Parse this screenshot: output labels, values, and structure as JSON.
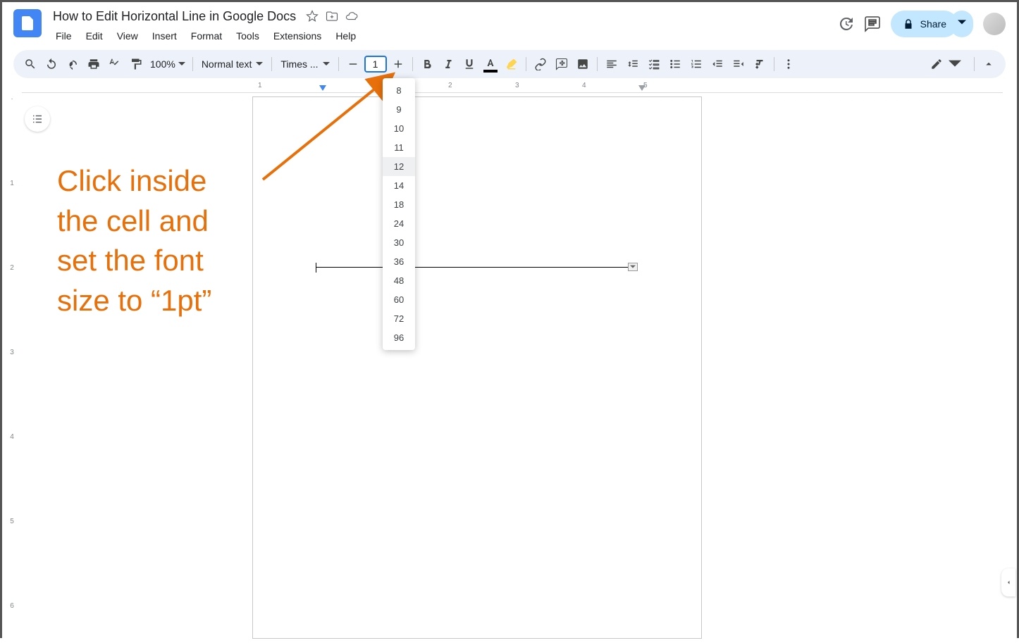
{
  "doc_title": "How to Edit Horizontal Line in Google Docs",
  "menus": [
    "File",
    "Edit",
    "View",
    "Insert",
    "Format",
    "Tools",
    "Extensions",
    "Help"
  ],
  "toolbar": {
    "zoom": "100%",
    "style": "Normal text",
    "font": "Times ...",
    "font_size": "1"
  },
  "share_label": "Share",
  "font_sizes": [
    "8",
    "9",
    "10",
    "11",
    "12",
    "14",
    "18",
    "24",
    "30",
    "36",
    "48",
    "60",
    "72",
    "96"
  ],
  "highlighted_size": "12",
  "hruler_ticks": [
    "1",
    "2",
    "3",
    "4",
    "5"
  ],
  "vruler_ticks": [
    "1",
    "2",
    "3",
    "4",
    "5",
    "6"
  ],
  "annotation_lines": [
    "Click inside",
    "the cell and",
    "set the font",
    "size to “1pt”"
  ]
}
